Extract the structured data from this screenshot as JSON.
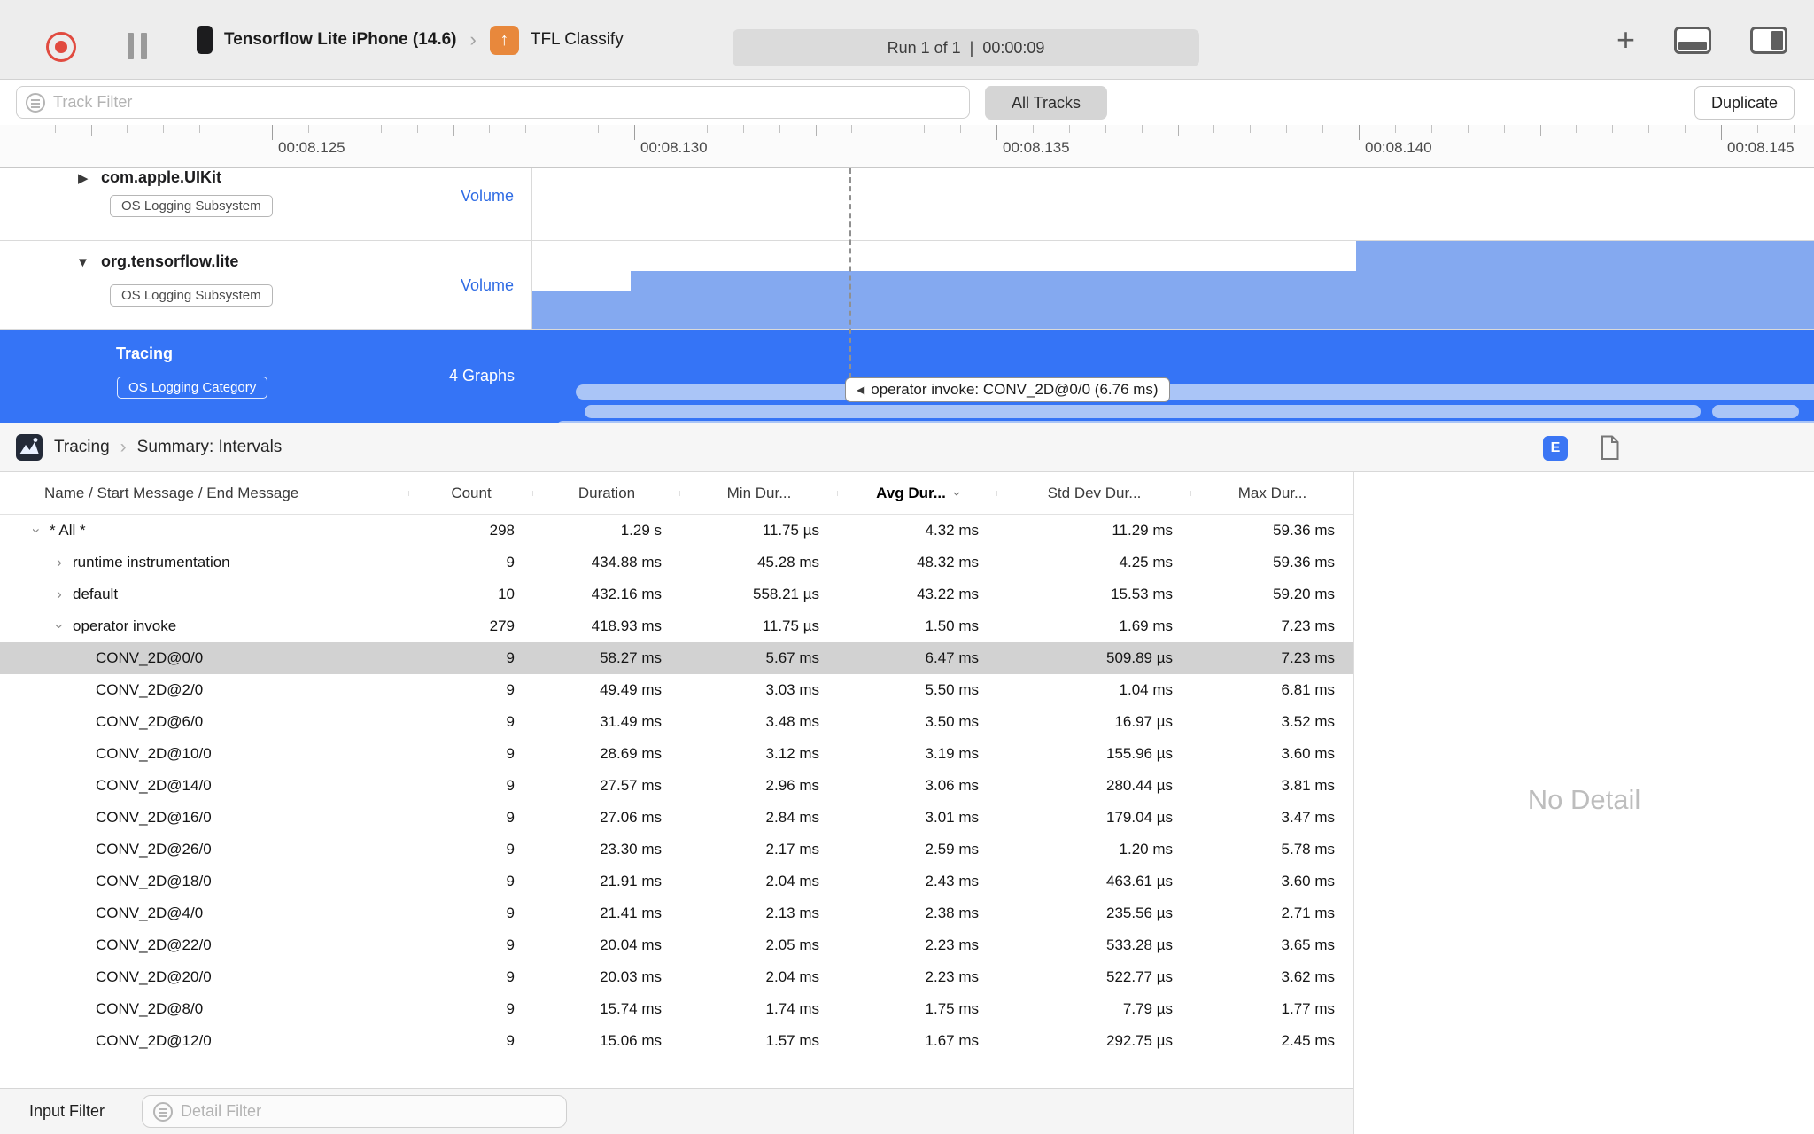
{
  "toolbar": {
    "device": "Tensorflow Lite iPhone (14.6)",
    "target": "TFL Classify",
    "run_status": "Run 1 of 1  |  00:00:09"
  },
  "filter_bar": {
    "track_filter_placeholder": "Track Filter",
    "all_tracks": "All Tracks",
    "duplicate": "Duplicate"
  },
  "ruler": {
    "labels": [
      "00:08.125",
      "00:08.130",
      "00:08.135",
      "00:08.140",
      "00:08.145"
    ]
  },
  "tracks": [
    {
      "title": "com.apple.UIKit",
      "badge": "OS Logging Subsystem",
      "meta": "Volume"
    },
    {
      "title": "org.tensorflow.lite",
      "badge": "OS Logging Subsystem",
      "meta": "Volume"
    },
    {
      "title": "Tracing",
      "badge": "OS Logging Category",
      "meta": "4 Graphs"
    }
  ],
  "timeline": {
    "selection_tooltip": "operator invoke: CONV_2D@0/0 (6.76 ms)"
  },
  "detail_bar": {
    "instrument": "Tracing",
    "view": "Summary: Intervals",
    "e_badge": "E"
  },
  "table": {
    "columns": [
      "Name / Start Message / End Message",
      "Count",
      "Duration",
      "Min Dur...",
      "Avg Dur...",
      "Std Dev Dur...",
      "Max Dur..."
    ],
    "sorted_column": "Avg Dur...",
    "rows": [
      {
        "name": "* All *",
        "level": 0,
        "disclosure": "down",
        "selected": false,
        "values": [
          "298",
          "1.29 s",
          "11.75 µs",
          "4.32 ms",
          "11.29 ms",
          "59.36 ms"
        ]
      },
      {
        "name": "runtime instrumentation",
        "level": 1,
        "disclosure": "right",
        "selected": false,
        "values": [
          "9",
          "434.88 ms",
          "45.28 ms",
          "48.32 ms",
          "4.25 ms",
          "59.36 ms"
        ]
      },
      {
        "name": "default",
        "level": 1,
        "disclosure": "right",
        "selected": false,
        "values": [
          "10",
          "432.16 ms",
          "558.21 µs",
          "43.22 ms",
          "15.53 ms",
          "59.20 ms"
        ]
      },
      {
        "name": "operator invoke",
        "level": 1,
        "disclosure": "down",
        "selected": false,
        "values": [
          "279",
          "418.93 ms",
          "11.75 µs",
          "1.50 ms",
          "1.69 ms",
          "7.23 ms"
        ]
      },
      {
        "name": "CONV_2D@0/0",
        "level": 2,
        "disclosure": "none",
        "selected": true,
        "values": [
          "9",
          "58.27 ms",
          "5.67 ms",
          "6.47 ms",
          "509.89 µs",
          "7.23 ms"
        ]
      },
      {
        "name": "CONV_2D@2/0",
        "level": 2,
        "disclosure": "none",
        "selected": false,
        "values": [
          "9",
          "49.49 ms",
          "3.03 ms",
          "5.50 ms",
          "1.04 ms",
          "6.81 ms"
        ]
      },
      {
        "name": "CONV_2D@6/0",
        "level": 2,
        "disclosure": "none",
        "selected": false,
        "values": [
          "9",
          "31.49 ms",
          "3.48 ms",
          "3.50 ms",
          "16.97 µs",
          "3.52 ms"
        ]
      },
      {
        "name": "CONV_2D@10/0",
        "level": 2,
        "disclosure": "none",
        "selected": false,
        "values": [
          "9",
          "28.69 ms",
          "3.12 ms",
          "3.19 ms",
          "155.96 µs",
          "3.60 ms"
        ]
      },
      {
        "name": "CONV_2D@14/0",
        "level": 2,
        "disclosure": "none",
        "selected": false,
        "values": [
          "9",
          "27.57 ms",
          "2.96 ms",
          "3.06 ms",
          "280.44 µs",
          "3.81 ms"
        ]
      },
      {
        "name": "CONV_2D@16/0",
        "level": 2,
        "disclosure": "none",
        "selected": false,
        "values": [
          "9",
          "27.06 ms",
          "2.84 ms",
          "3.01 ms",
          "179.04 µs",
          "3.47 ms"
        ]
      },
      {
        "name": "CONV_2D@26/0",
        "level": 2,
        "disclosure": "none",
        "selected": false,
        "values": [
          "9",
          "23.30 ms",
          "2.17 ms",
          "2.59 ms",
          "1.20 ms",
          "5.78 ms"
        ]
      },
      {
        "name": "CONV_2D@18/0",
        "level": 2,
        "disclosure": "none",
        "selected": false,
        "values": [
          "9",
          "21.91 ms",
          "2.04 ms",
          "2.43 ms",
          "463.61 µs",
          "3.60 ms"
        ]
      },
      {
        "name": "CONV_2D@4/0",
        "level": 2,
        "disclosure": "none",
        "selected": false,
        "values": [
          "9",
          "21.41 ms",
          "2.13 ms",
          "2.38 ms",
          "235.56 µs",
          "2.71 ms"
        ]
      },
      {
        "name": "CONV_2D@22/0",
        "level": 2,
        "disclosure": "none",
        "selected": false,
        "values": [
          "9",
          "20.04 ms",
          "2.05 ms",
          "2.23 ms",
          "533.28 µs",
          "3.65 ms"
        ]
      },
      {
        "name": "CONV_2D@20/0",
        "level": 2,
        "disclosure": "none",
        "selected": false,
        "values": [
          "9",
          "20.03 ms",
          "2.04 ms",
          "2.23 ms",
          "522.77 µs",
          "3.62 ms"
        ]
      },
      {
        "name": "CONV_2D@8/0",
        "level": 2,
        "disclosure": "none",
        "selected": false,
        "values": [
          "9",
          "15.74 ms",
          "1.74 ms",
          "1.75 ms",
          "7.79 µs",
          "1.77 ms"
        ]
      },
      {
        "name": "CONV_2D@12/0",
        "level": 2,
        "disclosure": "none",
        "selected": false,
        "values": [
          "9",
          "15.06 ms",
          "1.57 ms",
          "1.67 ms",
          "292.75 µs",
          "2.45 ms"
        ]
      }
    ]
  },
  "detail_panel": {
    "empty": "No Detail"
  },
  "bottom_bar": {
    "label": "Input Filter",
    "placeholder": "Detail Filter"
  },
  "colors": {
    "selection_blue": "#3574f6",
    "volume_fill": "#84a9f0",
    "lane_fill": "#aac5f7",
    "record_red": "#e14b40",
    "volume_link_blue": "#2e6be4",
    "e_badge_blue": "#3b76f4"
  }
}
